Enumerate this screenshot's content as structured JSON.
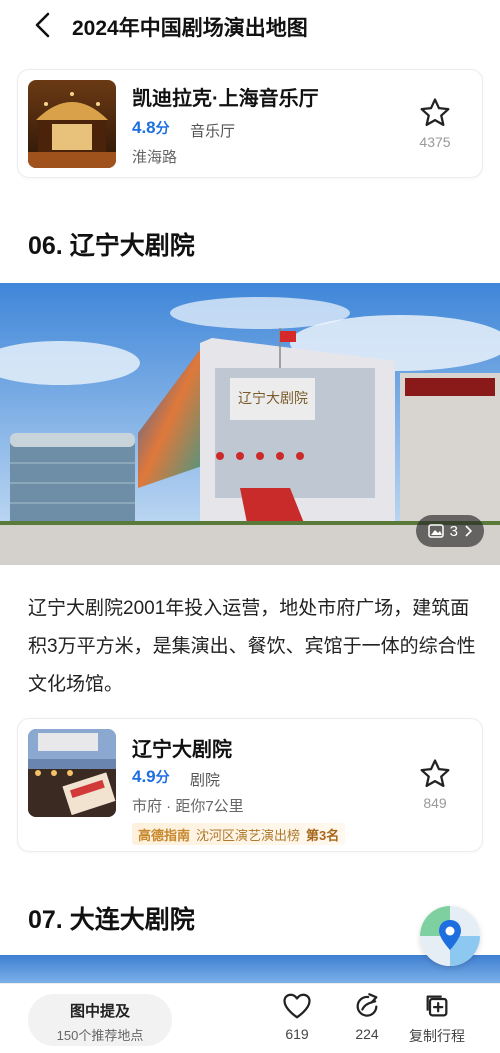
{
  "header": {
    "title": "2024年中国剧场演出地图"
  },
  "card1": {
    "name": "凯迪拉克·上海音乐厅",
    "rating": "4.8",
    "rating_unit": "分",
    "category": "音乐厅",
    "location": "淮海路",
    "favorites": "4375"
  },
  "section6": {
    "title": "06. 辽宁大剧院",
    "image_count": "3",
    "description": "辽宁大剧院2001年投入运营，地处市府广场，建筑面积3万平方米，是集演出、餐饮、宾馆于一体的综合性文化场馆。"
  },
  "card2": {
    "name": "辽宁大剧院",
    "rating": "4.9",
    "rating_unit": "分",
    "category": "剧院",
    "location": "市府 · 距你7公里",
    "favorites": "849",
    "rank_brand": "高德指南",
    "rank_list": "沈河区演艺演出榜",
    "rank_pos": "第3名"
  },
  "section7": {
    "title": "07. 大连大剧院"
  },
  "bottom": {
    "nearby_title": "图中提及",
    "nearby_sub": "150个推荐地点",
    "like_count": "619",
    "share_count": "224",
    "copy_label": "复制行程"
  },
  "colors": {
    "accent": "#1d6fe0",
    "rank_gold": "#c8872b"
  },
  "icons": [
    "chevron-left-icon",
    "star-icon",
    "image-icon",
    "heart-icon",
    "share-icon",
    "copy-plus-icon",
    "map-pin-icon"
  ]
}
